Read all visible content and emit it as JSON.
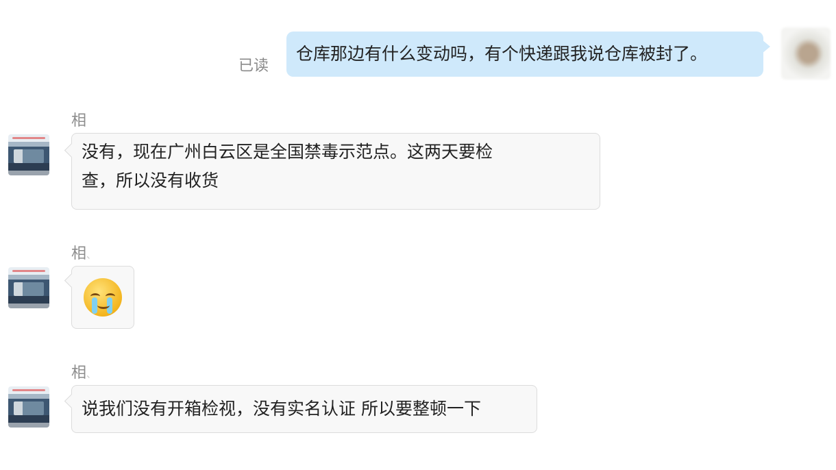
{
  "chat": {
    "outgoing": {
      "status": "已读",
      "text": "仓库那边有什么变动吗，有个快递跟我说仓库被封了。"
    },
    "incoming": [
      {
        "sender": "相",
        "sender_trail": "",
        "line1": "没有，现在广州白云区是全国禁毒示范点。这两天要检",
        "line2": "查，所以没有收货"
      },
      {
        "sender": "相",
        "sender_trail": "、",
        "emoji": "crying-face-emoji"
      },
      {
        "sender": "相",
        "sender_trail": "、",
        "text": "说我们没有开箱检视，没有实名认证 所以要整顿一下"
      }
    ]
  }
}
